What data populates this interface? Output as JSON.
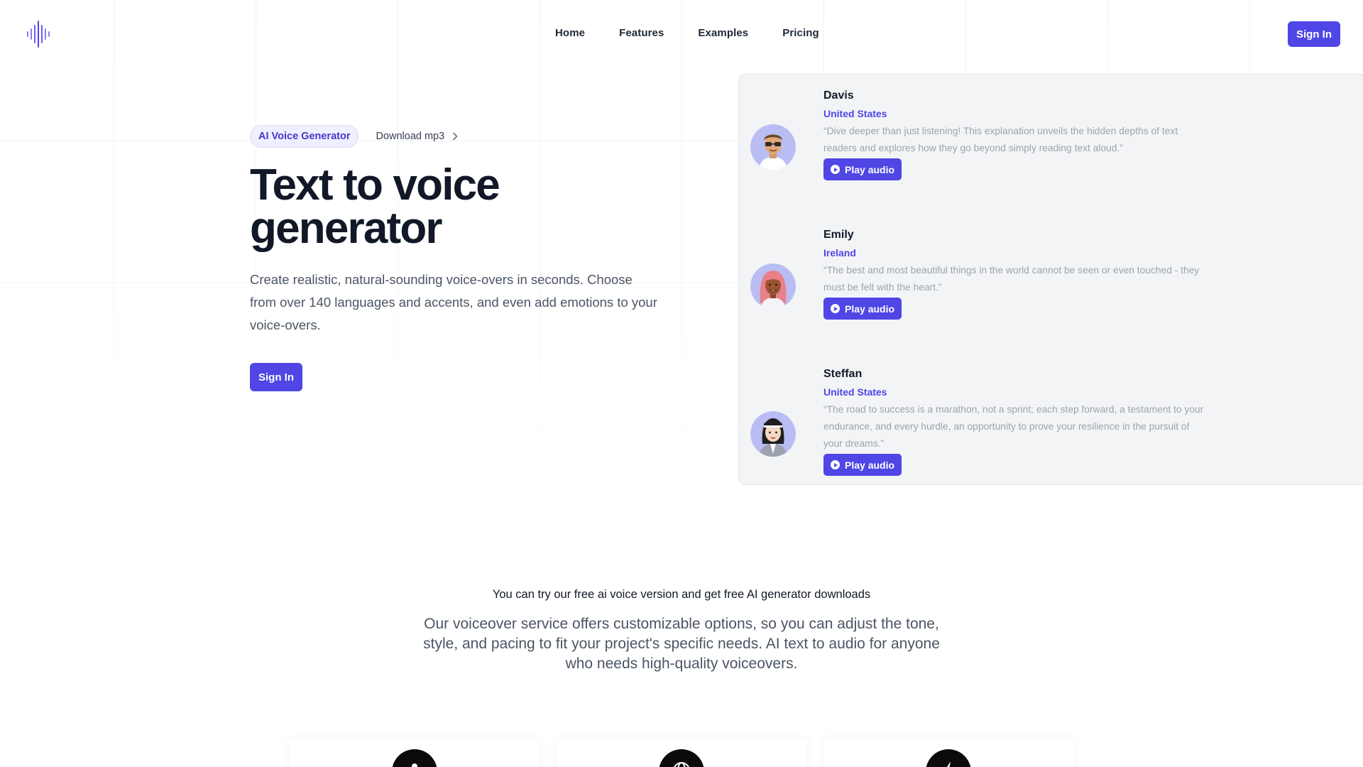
{
  "header": {
    "logo": "soundwave-logo",
    "nav": [
      "Home",
      "Features",
      "Examples",
      "Pricing"
    ],
    "signin_label": "Sign In"
  },
  "hero": {
    "badge": "AI Voice Generator",
    "download_link": "Download mp3",
    "title": "Text to voice generator",
    "description": "Create realistic, natural-sounding voice-overs in seconds. Choose from over 140 languages and accents, and even add emotions to your voice-overs.",
    "signin_label": "Sign In"
  },
  "voices": [
    {
      "name": "Davis",
      "location": "United States",
      "quote": "“Dive deeper than just listening! This explanation unveils the hidden depths of text readers and explores how they go beyond simply reading text aloud.”",
      "play_label": "Play audio"
    },
    {
      "name": "Emily",
      "location": "Ireland",
      "quote": "“The best and most beautiful things in the world cannot be seen or even touched - they must be felt with the heart.”",
      "play_label": "Play audio"
    },
    {
      "name": "Steffan",
      "location": "United States",
      "quote": "“The road to success is a marathon, not a sprint; each step forward, a testament to your endurance, and every hurdle, an opportunity to prove your resilience in the pursuit of your dreams.”",
      "play_label": "Play audio"
    }
  ],
  "section": {
    "title": "You can try our free ai voice version and get free AI generator downloads",
    "description": "Our voiceover service offers customizable options, so you can adjust the tone, style, and pacing to fit your project's specific needs. AI text to audio for anyone who needs high-quality voiceovers."
  },
  "feature_cards": [
    {
      "icon": "person-icon"
    },
    {
      "icon": "globe-icon"
    },
    {
      "icon": "lightning-icon"
    }
  ],
  "colors": {
    "accent": "#4f46e5",
    "panel_bg": "#f3f4f6",
    "quote_text": "#9ca3af"
  }
}
